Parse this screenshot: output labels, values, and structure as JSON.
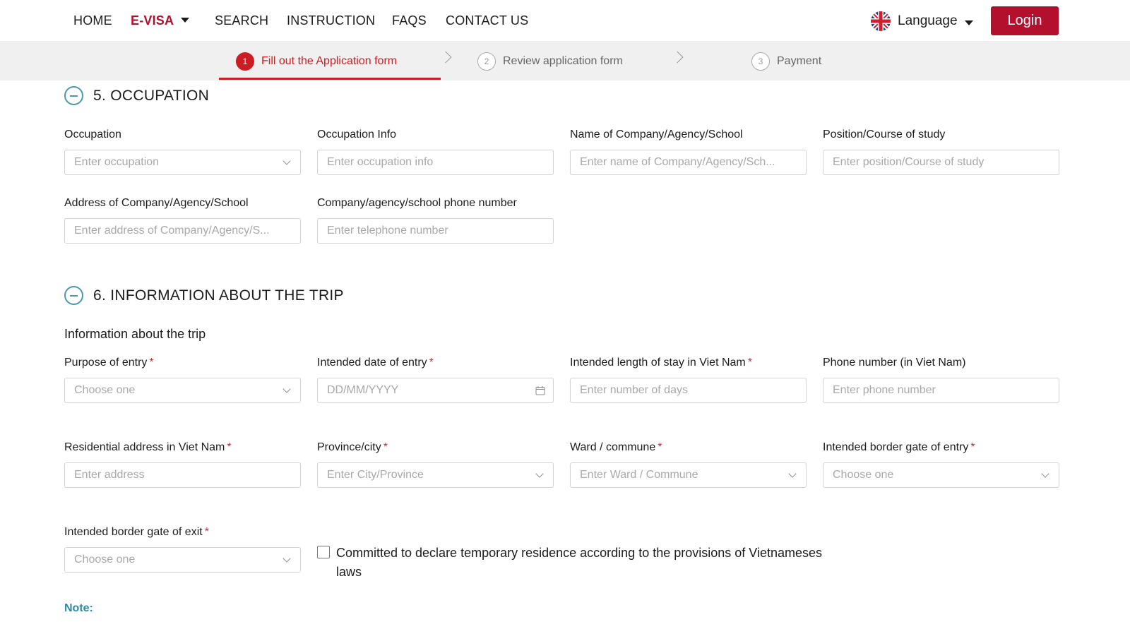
{
  "nav": {
    "items": [
      {
        "label": "HOME"
      },
      {
        "label": "E-VISA"
      },
      {
        "label": "SEARCH"
      },
      {
        "label": "INSTRUCTION"
      },
      {
        "label": "FAQS"
      },
      {
        "label": "CONTACT US"
      }
    ],
    "active_item": "E-VISA",
    "language_label": "Language",
    "language_flag": "uk-flag-icon",
    "login_label": "Login",
    "accent_color": "#b3102e"
  },
  "stepper": {
    "steps": [
      {
        "number": "1",
        "label": "Fill out the Application form",
        "active": true
      },
      {
        "number": "2",
        "label": "Review application form",
        "active": false
      },
      {
        "number": "3",
        "label": "Payment",
        "active": false
      }
    ],
    "active_color": "#cc1d22"
  },
  "occupation": {
    "title": "5. OCCUPATION",
    "fields": {
      "occupation": {
        "label": "Occupation",
        "placeholder": "Enter occupation",
        "type": "select"
      },
      "occupation_info": {
        "label": "Occupation Info",
        "placeholder": "Enter occupation info",
        "type": "text"
      },
      "company_name": {
        "label": "Name of Company/Agency/School",
        "placeholder": "Enter name of Company/Agency/Sch...",
        "type": "text"
      },
      "position": {
        "label": "Position/Course of study",
        "placeholder": "Enter position/Course of study",
        "type": "text"
      },
      "company_address": {
        "label": "Address of Company/Agency/School",
        "placeholder": "Enter address of Company/Agency/S...",
        "type": "text"
      },
      "company_phone": {
        "label": "Company/agency/school phone number",
        "placeholder": "Enter telephone number",
        "type": "text"
      }
    }
  },
  "trip": {
    "title": "6. INFORMATION ABOUT THE TRIP",
    "subheading": "Information about the trip",
    "required_mark": "*",
    "fields": {
      "purpose": {
        "label": "Purpose of entry",
        "placeholder": "Choose one",
        "required": true,
        "type": "select"
      },
      "entry_date": {
        "label": "Intended date of entry",
        "placeholder": "DD/MM/YYYY",
        "required": true,
        "type": "date"
      },
      "length_of_stay": {
        "label": "Intended length of stay in Viet Nam",
        "placeholder": "Enter number of days",
        "required": true,
        "type": "text"
      },
      "phone_vn": {
        "label": "Phone number (in Viet Nam)",
        "placeholder": "Enter phone number",
        "required": false,
        "type": "text"
      },
      "residential_address": {
        "label": "Residential address in Viet Nam",
        "placeholder": "Enter address",
        "required": true,
        "type": "text"
      },
      "province": {
        "label": "Province/city",
        "placeholder": "Enter City/Province",
        "required": true,
        "type": "select"
      },
      "ward": {
        "label": "Ward / commune",
        "placeholder": "Enter Ward / Commune",
        "required": true,
        "type": "select"
      },
      "entry_gate": {
        "label": "Intended border gate of entry",
        "placeholder": "Choose one",
        "required": true,
        "type": "select"
      },
      "exit_gate": {
        "label": "Intended border gate of exit",
        "placeholder": "Choose one",
        "required": true,
        "type": "select"
      }
    },
    "commitment_text": "Committed to declare temporary residence according to the provisions of Vietnameses laws",
    "commitment_checked": false
  },
  "note": {
    "label": "Note:"
  }
}
